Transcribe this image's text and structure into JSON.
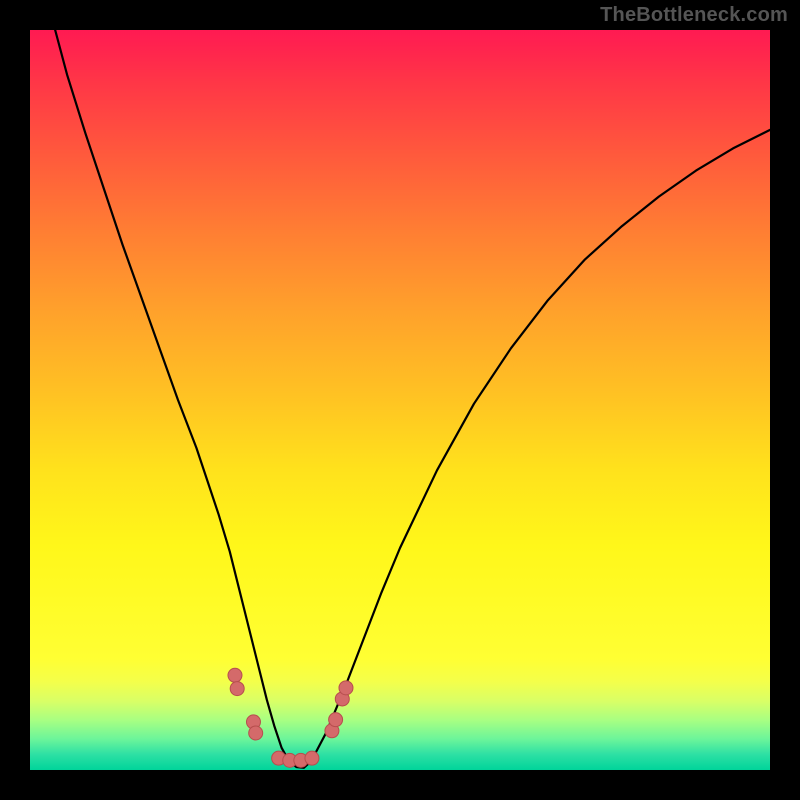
{
  "watermark": "TheBottleneck.com",
  "chart_data": {
    "type": "line",
    "title": "",
    "xlabel": "",
    "ylabel": "",
    "xlim": [
      0,
      100
    ],
    "ylim": [
      0,
      100
    ],
    "grid": false,
    "legend": false,
    "series": [
      {
        "name": "main-curve",
        "x": [
          3.4,
          5,
          7.5,
          10,
          12.5,
          15,
          17.5,
          20,
          22.5,
          24,
          25.5,
          27,
          28,
          29,
          30,
          31,
          32,
          33,
          34,
          35,
          36,
          37,
          38,
          40,
          42.5,
          45,
          47.5,
          50,
          55,
          60,
          65,
          70,
          75,
          80,
          85,
          90,
          95,
          100
        ],
        "y": [
          100,
          94,
          86,
          78.5,
          71,
          64,
          57,
          50,
          43.5,
          39,
          34.5,
          29.5,
          25.5,
          21.5,
          17.5,
          13.5,
          9.5,
          6,
          3,
          1.2,
          0.4,
          0.3,
          1.2,
          5,
          11,
          17.5,
          24,
          30,
          40.5,
          49.5,
          57,
          63.5,
          69,
          73.5,
          77.5,
          81,
          84,
          86.5
        ]
      }
    ],
    "markers": [
      {
        "name": "left-marker-upper-1",
        "x": 27.7,
        "y": 12.8
      },
      {
        "name": "left-marker-upper-2",
        "x": 28.0,
        "y": 11.0
      },
      {
        "name": "left-marker-lower-1",
        "x": 30.2,
        "y": 6.5
      },
      {
        "name": "left-marker-lower-2",
        "x": 30.5,
        "y": 5.0
      },
      {
        "name": "right-marker-lower-1",
        "x": 40.8,
        "y": 5.3
      },
      {
        "name": "right-marker-lower-2",
        "x": 41.3,
        "y": 6.8
      },
      {
        "name": "right-marker-upper-1",
        "x": 42.2,
        "y": 9.6
      },
      {
        "name": "right-marker-upper-2",
        "x": 42.7,
        "y": 11.1
      },
      {
        "name": "bottom-marker-1",
        "x": 33.6,
        "y": 1.6
      },
      {
        "name": "bottom-marker-2",
        "x": 35.1,
        "y": 1.3
      },
      {
        "name": "bottom-marker-3",
        "x": 36.6,
        "y": 1.3
      },
      {
        "name": "bottom-marker-4",
        "x": 38.1,
        "y": 1.6
      }
    ],
    "marker_style": {
      "color": "#d46a6a",
      "outline": "#b74e4e",
      "radius_px": 7
    },
    "background": {
      "stops": [
        {
          "pos": 0.0,
          "color": "#ff1a52"
        },
        {
          "pos": 0.5,
          "color": "#ffc223"
        },
        {
          "pos": 0.85,
          "color": "#ffff33"
        },
        {
          "pos": 1.0,
          "color": "#00d49a"
        }
      ]
    }
  },
  "frame": {
    "outer_size_px": 800,
    "border_px": 30,
    "border_color": "#000000"
  }
}
